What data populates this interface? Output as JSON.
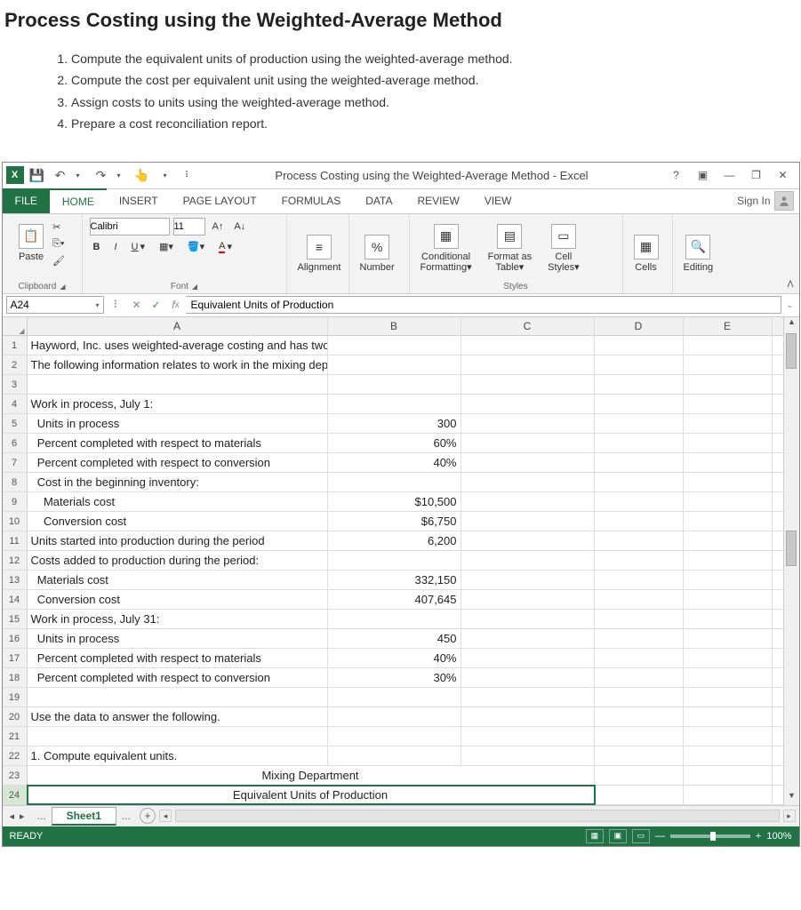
{
  "document": {
    "title": "Process Costing using the Weighted-Average Method",
    "steps": [
      "Compute the equivalent units of production using the weighted-average method.",
      "Compute the cost per equivalent unit using the weighted-average method.",
      "Assign costs to units using the weighted-average method.",
      "Prepare a cost reconciliation report."
    ]
  },
  "excel": {
    "titlebar": {
      "title": "Process Costing using the Weighted-Average Method - Excel"
    },
    "tabs": {
      "file": "FILE",
      "items": [
        "HOME",
        "INSERT",
        "PAGE LAYOUT",
        "FORMULAS",
        "DATA",
        "REVIEW",
        "VIEW"
      ],
      "active": "HOME",
      "signin": "Sign In"
    },
    "ribbon": {
      "clipboard": {
        "paste": "Paste",
        "label": "Clipboard"
      },
      "font": {
        "name": "Calibri",
        "size": "11",
        "label": "Font"
      },
      "alignment": {
        "label": "Alignment"
      },
      "number": {
        "label": "Number"
      },
      "styles": {
        "cond": "Conditional Formatting",
        "table": "Format as Table",
        "cell": "Cell Styles",
        "label": "Styles"
      },
      "cells": {
        "label": "Cells"
      },
      "editing": {
        "label": "Editing"
      }
    },
    "formula_bar": {
      "namebox": "A24",
      "formula": "Equivalent Units of Production"
    },
    "columns": [
      "A",
      "B",
      "C",
      "D",
      "E"
    ],
    "rows": [
      {
        "n": 1,
        "A": "Hayword, Inc. uses weighted-average costing and has two departments - mixing and packaging."
      },
      {
        "n": 2,
        "A": "The following information relates to work in the mixing department for the month of July:"
      },
      {
        "n": 3,
        "A": ""
      },
      {
        "n": 4,
        "A": "Work in process, July 1:"
      },
      {
        "n": 5,
        "A": "  Units in process",
        "B": "300"
      },
      {
        "n": 6,
        "A": "  Percent completed with respect to materials",
        "B": "60%"
      },
      {
        "n": 7,
        "A": "  Percent completed with respect to conversion",
        "B": "40%"
      },
      {
        "n": 8,
        "A": "  Cost in the beginning inventory:"
      },
      {
        "n": 9,
        "A": "    Materials cost",
        "B": "$10,500"
      },
      {
        "n": 10,
        "A": "    Conversion cost",
        "B": "$6,750"
      },
      {
        "n": 11,
        "A": "Units started into production during the period",
        "B": "6,200"
      },
      {
        "n": 12,
        "A": "Costs added to production during the period:"
      },
      {
        "n": 13,
        "A": "  Materials cost",
        "B": "332,150"
      },
      {
        "n": 14,
        "A": "  Conversion cost",
        "B": "407,645"
      },
      {
        "n": 15,
        "A": "Work in process, July 31:"
      },
      {
        "n": 16,
        "A": "  Units in process",
        "B": "450"
      },
      {
        "n": 17,
        "A": "  Percent completed with respect to materials",
        "B": "40%"
      },
      {
        "n": 18,
        "A": "  Percent completed with respect to conversion",
        "B": "30%"
      },
      {
        "n": 19,
        "A": ""
      },
      {
        "n": 20,
        "A": "Use the data to answer the following."
      },
      {
        "n": 21,
        "A": ""
      },
      {
        "n": 22,
        "A": "1. Compute equivalent units."
      },
      {
        "n": 23,
        "merge": "ABC",
        "centered": true,
        "val": "Mixing Department"
      },
      {
        "n": 24,
        "merge": "ABC",
        "centered": true,
        "val": "Equivalent Units of Production",
        "active": true
      }
    ],
    "sheetbar": {
      "sheet": "Sheet1"
    },
    "statusbar": {
      "ready": "READY",
      "zoom": "100%"
    }
  }
}
